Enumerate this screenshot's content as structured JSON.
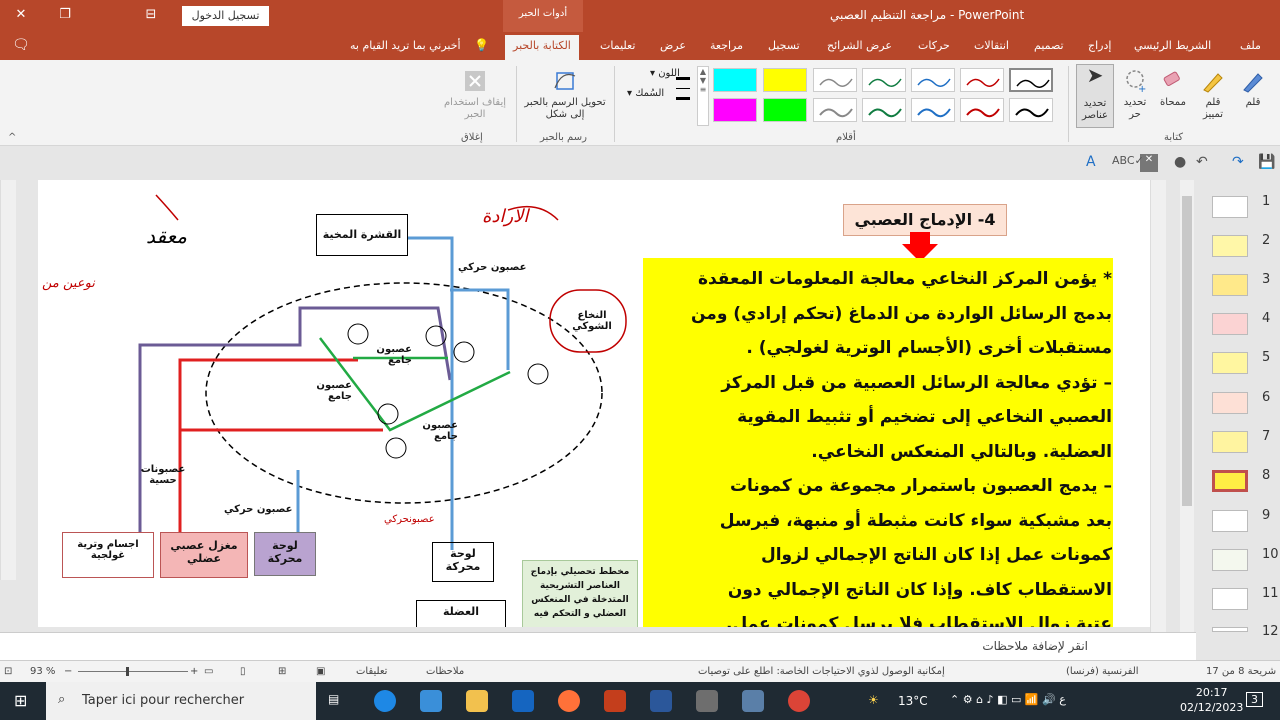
{
  "titlebar": {
    "doc_title": "مراجعة التنظيم العصبي  -  PowerPoint",
    "context_tab": "أدوات الحبر",
    "signin": "تسجيل الدخول",
    "close": "✕",
    "restore": "❐",
    "minimize": "—"
  },
  "tabs": [
    "ملف",
    "الشريط الرئيسي",
    "إدراج",
    "تصميم",
    "انتقالات",
    "حركات",
    "عرض الشرائح",
    "تسجيل",
    "مراجعة",
    "عرض",
    "تعليمات",
    "الكتابة بالحبر"
  ],
  "tell_me": "أخبرني بما تريد القيام به",
  "ribbon": {
    "tools": [
      {
        "label": "قلم"
      },
      {
        "label": "قلم تمييز"
      },
      {
        "label": "ممحاة"
      },
      {
        "label": "تحديد حر"
      },
      {
        "label": "تحديد عناصر"
      }
    ],
    "group_writing": "كتابة",
    "group_pens": "أقلام",
    "color_label": "اللون",
    "thickness_label": "السُمك",
    "convert_label": "تحويل الرسم بالحبر إلى شكل",
    "group_draw": "رسم بالحبر",
    "stop_label": "إيقاف استخدام الحبر",
    "group_close": "إغلاق",
    "pen_colors": [
      "#000000",
      "#c00000",
      "#1f6fc5",
      "#107c41",
      "#888888",
      "#107c41",
      "#c00000",
      "#1f6fc5",
      "#000000"
    ],
    "highlight_colors": [
      "#00ffff",
      "#ffff00",
      "#ff00ff",
      "#00ff00"
    ]
  },
  "slide": {
    "heading": "4- الإدماج العصبي",
    "paragraph_lines": [
      "* يؤمن المركز النخاعي معالجة المعلومات المعقدة",
      "بدمج الرسائل الواردة من الدماغ (تحكم إرادي) ومن",
      "مستقبلات أخرى (الأجسام الوترية لغولجي) .",
      "– تؤدي معالجة الرسائل العصبية من قبل المركز",
      "العصبي النخاعي إلى تضخيم أو تثبيط المقوية",
      "العضلية. وبالتالي المنعكس النخاعي.",
      "– يدمج العصبون باستمرار مجموعة من كمونات",
      "بعد مشبكية سواء كانت مثبطة أو منبهة، فيرسل",
      "كمونات عمل إذا كان الناتج الإجمالي لزوال",
      "الاستقطاب كاف. وإذا كان الناتج الإجمالي دون",
      "عتبة زوال الاستقطاب فلا يرسل كمونات عمل."
    ],
    "diagram_labels": {
      "cortex": "القشرة المخية",
      "motor_neuron_top": "عصبون حركي",
      "spinal_cord": "النخاع الشوكي",
      "interneuron1": "عصبون جامع",
      "interneuron2": "عصبون جامع",
      "interneuron3": "عصبون جامع",
      "sensory": "عصبونات حسية",
      "motor": "عصبون حركي",
      "golgi": "اجسام وترية غولجية",
      "spindle": "مغزل عصبي عضلي",
      "plate1": "لوحة محركة",
      "plate2": "لوحة محركة",
      "muscle": "العضلة",
      "summary": "مخطط تحصيلي بإدماج العناصر التشريحية المتدخلة في المنعكس العضلي و التحكم فيه",
      "plus": "+",
      "minus": "-"
    },
    "handwritten": {
      "will": "الارادة",
      "complex": "معقد",
      "motor_nn": "عصبونحركي",
      "two_responses": "نوعين من"
    }
  },
  "notes_placeholder": "انقر لإضافة ملاحظات",
  "thumbnails": [
    "1",
    "2",
    "3",
    "4",
    "5",
    "6",
    "7",
    "8",
    "9",
    "10",
    "11",
    "12"
  ],
  "status": {
    "slide_count": "شريحة 8 من 17",
    "language": "الفرنسية (فرنسا)",
    "accessibility": "إمكانية الوصول لذوي الاحتياجات الخاصة: اطلع على توصيات",
    "notes": "ملاحظات",
    "comments": "تعليقات",
    "zoom": "93 %"
  },
  "taskbar": {
    "search": "Taper ici pour rechercher",
    "weather": "13°C",
    "time": "20:17",
    "date": "02/12/2023",
    "notif": "3"
  }
}
